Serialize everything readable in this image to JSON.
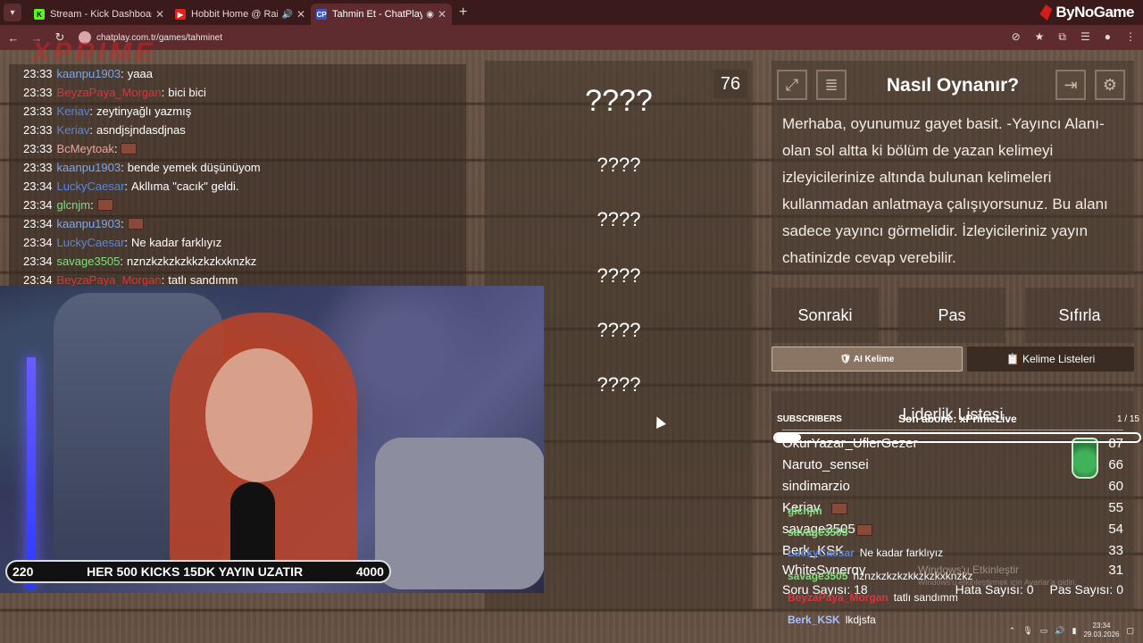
{
  "browser": {
    "tabs": [
      {
        "title": "Stream - Kick Dashboard",
        "favicon": "K",
        "active": false
      },
      {
        "title": "Hobbit Home @ Rainy Wint",
        "favicon": "▶",
        "active": false
      },
      {
        "title": "Tahmin Et - ChatPlay",
        "favicon": "CP",
        "active": true
      }
    ],
    "url": "chatplay.com.tr/games/tahminet",
    "brand": "ByNoGame"
  },
  "overlay_logo": "XPRIME",
  "chat": [
    {
      "time": "23:33",
      "user": "kaanpu1903",
      "color": "#7fa6e6",
      "msg": "yaaa"
    },
    {
      "time": "23:33",
      "user": "BeyzaPaya_Morgan",
      "color": "#e0323c",
      "msg": "bici bici"
    },
    {
      "time": "23:33",
      "user": "Keriav",
      "color": "#5a86d8",
      "msg": "zeytinyağlı yazmış"
    },
    {
      "time": "23:33",
      "user": "Keriav",
      "color": "#5a86d8",
      "msg": "asndjsjndasdjnas"
    },
    {
      "time": "23:33",
      "user": "BcMeytoak",
      "color": "#e6a4a4",
      "msg": "",
      "emote": true
    },
    {
      "time": "23:33",
      "user": "kaanpu1903",
      "color": "#7fa6e6",
      "msg": "bende yemek düşünüyom"
    },
    {
      "time": "23:34",
      "user": "LuckyCaesar",
      "color": "#5a86d8",
      "msg": "Akllıma \"cacık\" geldi."
    },
    {
      "time": "23:34",
      "user": "glcnjm",
      "color": "#7de07d",
      "msg": "",
      "emote": true
    },
    {
      "time": "23:34",
      "user": "kaanpu1903",
      "color": "#7fa6e6",
      "msg": "",
      "emote": true
    },
    {
      "time": "23:34",
      "user": "LuckyCaesar",
      "color": "#5a86d8",
      "msg": "Ne kadar farklıyız"
    },
    {
      "time": "23:34",
      "user": "savage3505",
      "color": "#7de07d",
      "msg": "nznzkzkzkzkkzkzkxknzkz"
    },
    {
      "time": "23:34",
      "user": "BeyzaPaya_Morgan",
      "color": "#e0323c",
      "msg": "tatlı sandımm"
    },
    {
      "time": "23:34",
      "user": "Berk_KSK",
      "color": "#a8c0ff",
      "msg": "lkdjsfa"
    }
  ],
  "game": {
    "counter": "76",
    "main_word": "????",
    "forbidden_words": [
      "????",
      "????",
      "????",
      "????",
      "????"
    ]
  },
  "howto": {
    "title": "Nasıl Oynanır?",
    "text": "Merhaba, oyunumuz gayet basit. -Yayıncı Alanı- olan sol altta ki bölüm de yazan kelimeyi izleyicilerinize altında bulunan kelimeleri kullanmadan anlatmaya çalışıyorsunuz. Bu alanı sadece yayıncı görmelidir. İzleyicileriniz yayın chatinizde cevap verebilir."
  },
  "actions": {
    "next": "Sonraki",
    "pass": "Pas",
    "reset": "Sıfırla",
    "ai_word": "🛡 AI Kelime",
    "word_lists": "📋 Kelime Listeleri"
  },
  "leaderboard": {
    "title": "Liderlik Listesi",
    "rows": [
      {
        "name": "OkurYazar_UflerGezer",
        "score": "87"
      },
      {
        "name": "Naruto_sensei",
        "score": "66"
      },
      {
        "name": "sindimarzio",
        "score": "60"
      },
      {
        "name": "Keriav",
        "score": "55"
      },
      {
        "name": "savage3505",
        "score": "54"
      },
      {
        "name": "Berk_KSK",
        "score": "33"
      },
      {
        "name": "WhiteSynergy",
        "score": "31"
      }
    ],
    "question_count": "Soru Sayısı: 18",
    "error_count": "Hata Sayısı: 0",
    "pass_count": "Pas Sayısı: 0"
  },
  "kickbar": {
    "left": "220",
    "text": "HER 500 KICKS 15DK YAYIN UZATIR",
    "right": "4000"
  },
  "subs": {
    "label": "SUBSCRIBERS",
    "latest": "Son abone: xPrimeLive",
    "count": "1 / 15",
    "progress": 0.07
  },
  "overlay_chat": [
    {
      "user": "glcnjm",
      "msg": "",
      "color": "#7de07d"
    },
    {
      "user": "savage3505",
      "msg": "",
      "color": "#7de07d"
    },
    {
      "user": "LuckyCaesar",
      "msg": "Ne kadar farklıyız",
      "color": "#5a86d8"
    },
    {
      "user": "savage3505",
      "msg": "nznzkzkzkzkkzkzkxknzkz",
      "color": "#7de07d"
    },
    {
      "user": "BeyzaPaya_Morgan",
      "msg": "tatlı sandımm",
      "color": "#e0323c"
    },
    {
      "user": "Berk_KSK",
      "msg": "lkdjsfa",
      "color": "#a8c0ff"
    }
  ],
  "windows_watermark": {
    "line1": "Windows'u Etkinleştir",
    "line2": "Windows'u etkinleştirmek için Ayarlar'a gidin."
  },
  "tray": {
    "time": "23:34",
    "date": "29.03.2026"
  }
}
